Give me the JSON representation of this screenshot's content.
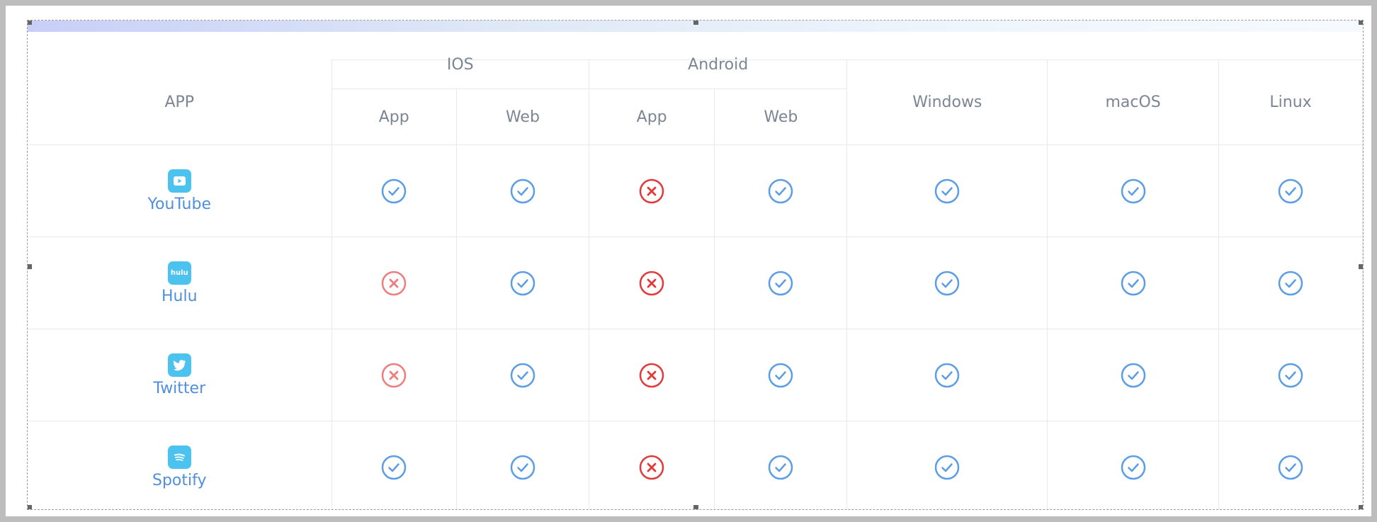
{
  "table": {
    "app_header": "APP",
    "groups": [
      {
        "label": "IOS",
        "subs": [
          "App",
          "Web"
        ]
      },
      {
        "label": "Android",
        "subs": [
          "App",
          "Web"
        ]
      }
    ],
    "single_columns": [
      "Windows",
      "macOS",
      "Linux"
    ],
    "rows": [
      {
        "name": "YouTube",
        "icon": "youtube-icon",
        "support": [
          "yes",
          "yes",
          "no",
          "yes",
          "yes",
          "yes",
          "yes"
        ]
      },
      {
        "name": "Hulu",
        "icon": "hulu-icon",
        "icon_text": "hulu",
        "support": [
          "no",
          "yes",
          "no",
          "yes",
          "yes",
          "yes",
          "yes"
        ]
      },
      {
        "name": "Twitter",
        "icon": "twitter-icon",
        "support": [
          "no",
          "yes",
          "no",
          "yes",
          "yes",
          "yes",
          "yes"
        ]
      },
      {
        "name": "Spotify",
        "icon": "spotify-icon",
        "support": [
          "yes",
          "yes",
          "no",
          "yes",
          "yes",
          "yes",
          "yes"
        ]
      }
    ]
  },
  "colors": {
    "check": "#5b9ee6",
    "cross_light": "#ef7d7d",
    "cross_dark": "#e03a3a",
    "app_icon_bg": "#4cc3ee",
    "app_name": "#4f8fdb"
  }
}
